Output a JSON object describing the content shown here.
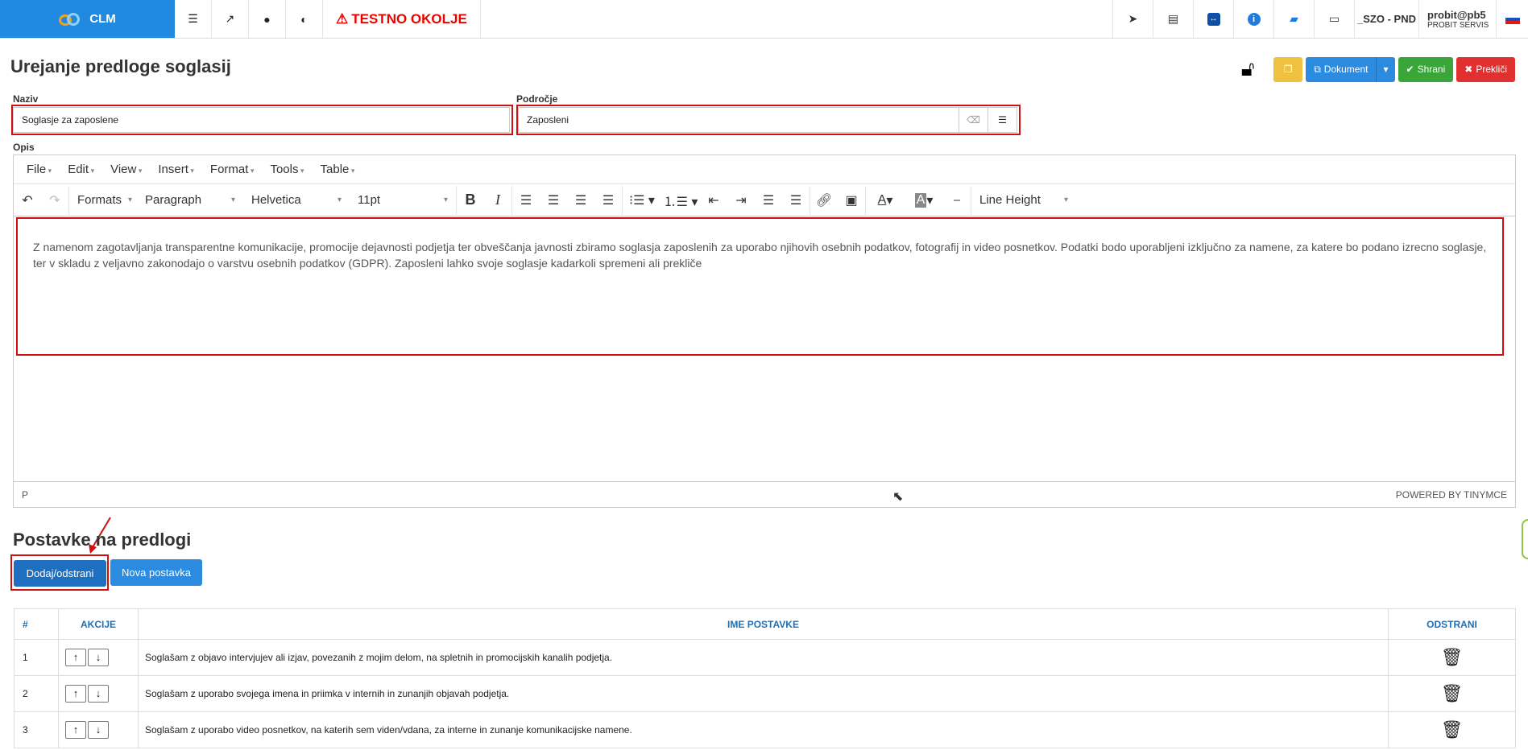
{
  "topbar": {
    "app_name": "CLM",
    "env_label": "TESTNO OKOLJE",
    "org": "_SZO - PND",
    "user_name": "probit@pb5",
    "user_org": "PROBIT SERVIS"
  },
  "page": {
    "title": "Urejanje predloge soglasij"
  },
  "actions": {
    "dokument": "Dokument",
    "shrani": "Shrani",
    "preklici": "Prekliči"
  },
  "form": {
    "naziv_label": "Naziv",
    "naziv_value": "Soglasje za zaposlene",
    "podrocje_label": "Področje",
    "podrocje_value": "Zaposleni",
    "opis_label": "Opis"
  },
  "editor": {
    "menu": [
      "File",
      "Edit",
      "View",
      "Insert",
      "Format",
      "Tools",
      "Table"
    ],
    "formats": "Formats",
    "block": "Paragraph",
    "font": "Helvetica",
    "size": "11pt",
    "line_height": "Line Height",
    "content": "Z namenom zagotavljanja transparentne komunikacije, promocije dejavnosti podjetja ter obveščanja javnosti zbiramo soglasja zaposlenih za uporabo njihovih osebnih podatkov, fotografij in video posnetkov. Podatki bodo uporabljeni izključno za namene, za katere bo podano izrecno soglasje, ter v skladu z veljavno zakonodajo o varstvu osebnih podatkov (GDPR). Zaposleni lahko svoje soglasje kadarkoli spremeni ali prekliče",
    "path": "P",
    "powered": "POWERED BY TINYMCE"
  },
  "items_section": {
    "title": "Postavke na predlogi",
    "add_remove": "Dodaj/odstrani",
    "new_item": "Nova postavka",
    "headers": [
      "#",
      "AKCIJE",
      "IME POSTAVKE",
      "ODSTRANI"
    ],
    "rows": [
      {
        "num": "1",
        "name": "Soglašam z objavo intervjujev ali izjav, povezanih z mojim delom, na spletnih in promocijskih kanalih podjetja."
      },
      {
        "num": "2",
        "name": "Soglašam z uporabo svojega imena in priimka v internih in zunanjih objavah podjetja."
      },
      {
        "num": "3",
        "name": "Soglašam z uporabo video posnetkov, na katerih sem viden/vdana, za interne in zunanje komunikacijske namene."
      }
    ]
  },
  "colors": {
    "brand": "#1f8ae0",
    "warning": "#f0c040",
    "primary": "#2a8be0",
    "success": "#3aa63a",
    "danger": "#e03030",
    "highlight": "#d01010"
  }
}
